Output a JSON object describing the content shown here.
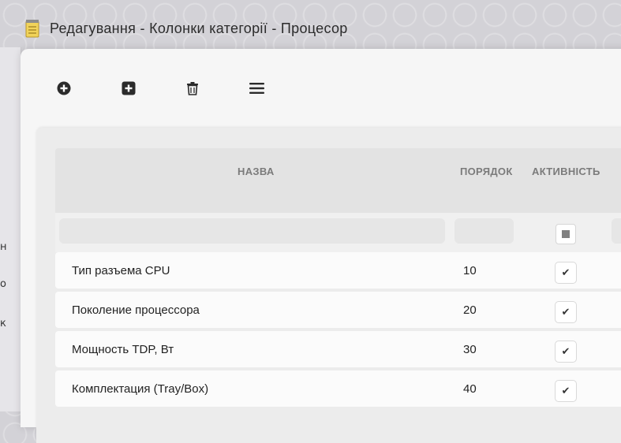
{
  "window": {
    "title": "Редагування - Колонки категорії - Процесор"
  },
  "left_edge": {
    "fragments": [
      "н",
      "о",
      "к"
    ]
  },
  "toolbar": {
    "icons": [
      "plus-circle-icon",
      "plus-square-icon",
      "trash-icon",
      "menu-icon"
    ]
  },
  "table": {
    "columns": {
      "name": "НАЗВА",
      "order": "ПОРЯДОК",
      "active": "АКТИВНІСТЬ"
    },
    "rows": [
      {
        "name": "Тип разъема CPU",
        "order": "10",
        "active_mark": "✔"
      },
      {
        "name": "Поколение процессора",
        "order": "20",
        "active_mark": "✔"
      },
      {
        "name": "Мощность TDP, Вт",
        "order": "30",
        "active_mark": "✔"
      },
      {
        "name": "Комплектация (Tray/Box)",
        "order": "40",
        "active_mark": "✔"
      }
    ]
  },
  "colors": {
    "background": "#d3d2d7",
    "window": "#f6f6f6",
    "header": "#e3e3e3",
    "icon": "#2b2b2b"
  }
}
